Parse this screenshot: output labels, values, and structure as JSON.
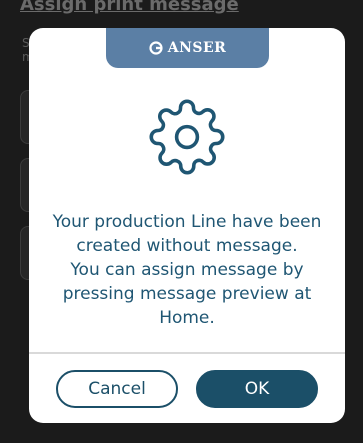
{
  "background": {
    "title": "Assign print message",
    "subtitle": "S m"
  },
  "modal": {
    "brand": {
      "name": "ANSER",
      "color": "#5b7fa5"
    },
    "icon": "gear-icon",
    "message": "Your production Line have been created without message.\nYou can assign message by pressing message preview at Home.",
    "text_color": "#1f5673",
    "buttons": {
      "cancel_label": "Cancel",
      "ok_label": "OK"
    },
    "accent_color": "#1b4f68"
  }
}
